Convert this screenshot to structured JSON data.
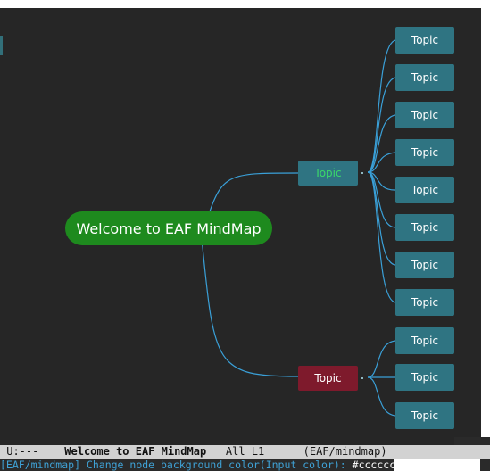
{
  "root": {
    "label": "Welcome to EAF MindMap"
  },
  "branches": [
    {
      "label": "Topic",
      "color": "#2f7482",
      "text_color": "#3ad86a"
    },
    {
      "label": "Topic",
      "color": "#7e1a2c",
      "text_color": "#ffffff"
    }
  ],
  "leaves": [
    {
      "label": "Topic"
    },
    {
      "label": "Topic"
    },
    {
      "label": "Topic"
    },
    {
      "label": "Topic"
    },
    {
      "label": "Topic"
    },
    {
      "label": "Topic"
    },
    {
      "label": "Topic"
    },
    {
      "label": "Topic"
    },
    {
      "label": "Topic"
    },
    {
      "label": "Topic"
    },
    {
      "label": "Topic"
    }
  ],
  "modeline": {
    "status": "U:---",
    "buffer": "Welcome to EAF MindMap",
    "position": "All L1",
    "mode": "(EAF/mindmap)"
  },
  "minibuffer": {
    "prompt": "[EAF/mindmap] Change node background color(Input color): ",
    "input": "#cccccc"
  },
  "colors": {
    "canvas": "#262626",
    "root": "#1e8a1e",
    "link": "#3aa0d8",
    "leaf": "#2f7482"
  }
}
